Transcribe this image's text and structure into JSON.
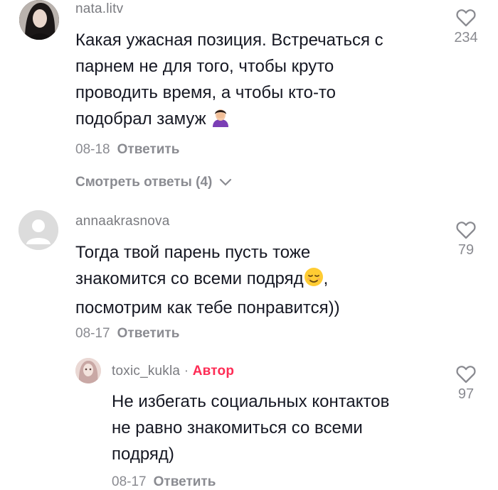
{
  "comments": [
    {
      "username": "nata.litv",
      "text_lines": [
        "Какая ужасная позиция. Встречаться с",
        "парнем не для того, чтобы круто",
        "проводить время, а чтобы кто-то",
        "подобрал замуж"
      ],
      "emoji": "facepalm-emoji",
      "date": "08-18",
      "reply_label": "Ответить",
      "likes": "234",
      "view_replies": "Смотреть ответы (4)"
    },
    {
      "username": "annaakrasnova",
      "text_lines": [
        "Тогда твой парень пусть тоже",
        "знакомится со всеми подряд",
        "посмотрим как тебе понравится))"
      ],
      "emoji": "relieved-face-emoji",
      "emoji_suffix": ",",
      "date": "08-17",
      "reply_label": "Ответить",
      "likes": "79"
    },
    {
      "username": "toxic_kukla",
      "separator": "·",
      "author_badge": "Автор",
      "text_lines": [
        "Не избегать социальных контактов",
        "не равно знакомиться со всеми",
        "подряд)"
      ],
      "date": "08-17",
      "reply_label": "Ответить",
      "likes": "97"
    }
  ],
  "icons": {
    "like": "heart-outline-icon",
    "expand": "chevron-down-icon"
  },
  "colors": {
    "text": "#161823",
    "muted": "#8a8b91",
    "author": "#fe2c55"
  }
}
